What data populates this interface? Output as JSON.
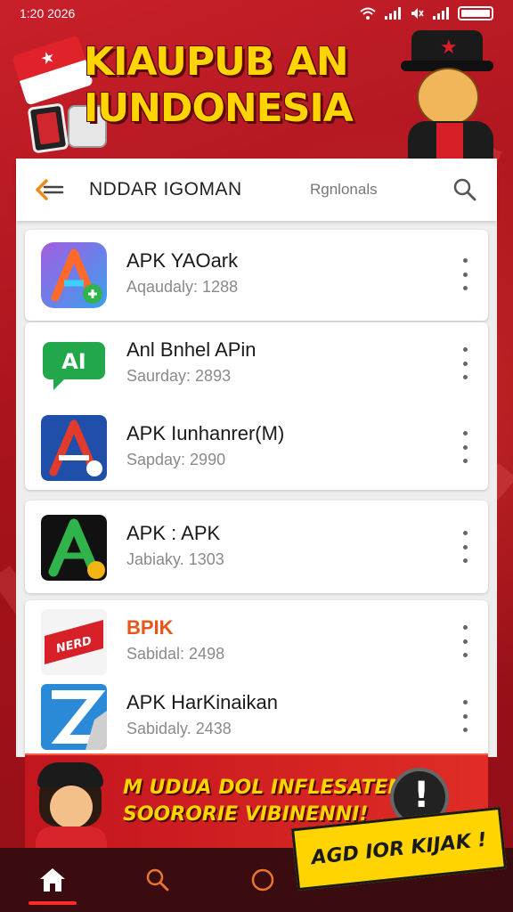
{
  "status_bar": {
    "time": "1:20 2026"
  },
  "banner": {
    "title_line1": "KIAUPUB AN",
    "title_line2": "IUNDONESIA"
  },
  "toolbar": {
    "title": "NDDAR IGOMAN",
    "sort_label": "Rgnlonals"
  },
  "apps": [
    {
      "name": "APK YAOark",
      "meta": "Aqaudaly: 1288",
      "icon": "gradient-a-icon"
    },
    {
      "name": "Anl Bnhel APin",
      "meta": "Saurday: 2893",
      "icon": "green-chat-icon"
    },
    {
      "name": "APK Iunhanrer(M)",
      "meta": "Sapday: 2990",
      "icon": "blue-a-icon"
    },
    {
      "name": "APK : APK",
      "meta": "Jabiaky. 1303",
      "icon": "green-a-icon"
    },
    {
      "name": "BPIK",
      "meta": "Sabidal: 2498",
      "icon": "red-tag-icon",
      "name_color": "#e8541c"
    },
    {
      "name": "APK HarKinaikan",
      "meta": "Sabidaly. 2438",
      "icon": "blue-z-icon"
    }
  ],
  "promo": {
    "line1": "M UDUA DOL INFLESATEN",
    "line2": "SOORORIE VIBINENNI!"
  },
  "cta": {
    "label": "AGD IOR KIJAK !"
  },
  "nav": [
    "home-icon",
    "search-icon",
    "circle-icon"
  ],
  "colors": {
    "accent": "#ffd400",
    "brand_red": "#c8202a",
    "nav_bg": "#3a0c10",
    "nav_active": "#ff2a2a"
  }
}
